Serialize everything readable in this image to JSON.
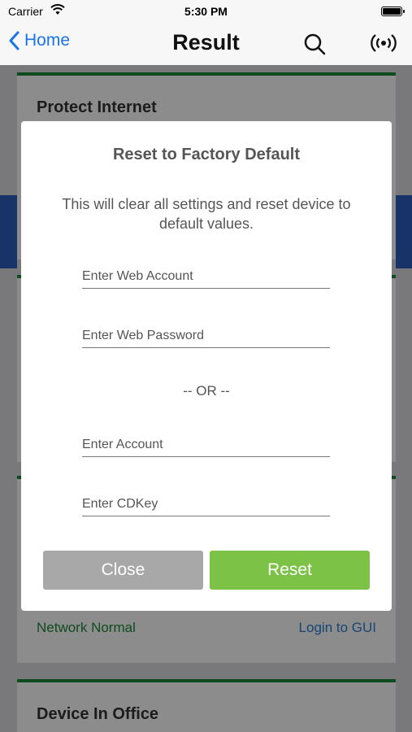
{
  "status_bar": {
    "carrier": "Carrier",
    "time": "5:30 PM"
  },
  "nav": {
    "back_label": "Home",
    "title": "Result"
  },
  "background_cards": {
    "card1_title": "Protect Internet",
    "status_text": "Network Normal",
    "login_link": "Login to GUI",
    "card3_title": "Device In Office"
  },
  "dialog": {
    "title": "Reset to Factory Default",
    "message": "This will clear all settings and reset device to default values.",
    "web_account_placeholder": "Enter Web Account",
    "web_password_placeholder": "Enter Web Password",
    "or_text": "-- OR --",
    "account_placeholder": "Enter Account",
    "cdkey_placeholder": "Enter CDKey",
    "close_label": "Close",
    "reset_label": "Reset"
  },
  "colors": {
    "accent_green": "#7cc247",
    "card_border_green": "#1a8a3a",
    "link_blue": "#1a73e8"
  }
}
